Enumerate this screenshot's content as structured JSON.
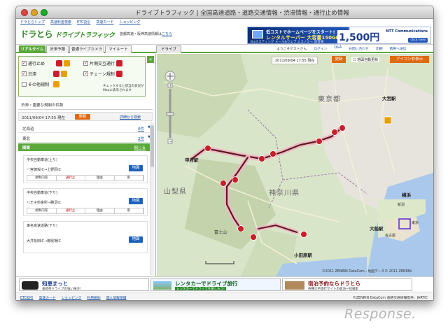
{
  "window": {
    "title": "ドライブトラフィック | 全国高速道路・道路交通情報・渋滞情報・通行止め情報"
  },
  "topnav": [
    "ドラとらトップ",
    "高速料金検索",
    "ETC割引",
    "高速カード",
    "ショッピング"
  ],
  "header": {
    "logo_main": "ドラとら",
    "logo_sub": "ドライブトラフィック",
    "area_note": "首都高速・阪神高速情報は",
    "area_link": "こちら"
  },
  "ad_top": {
    "line1": "低コストでホームページをスタート!",
    "line2": "レンタルサーバー 大容量150GB",
    "line3": "Bizホスティング メール&ウェブ エコノミー 新登場",
    "price": "1,500円",
    "brand": "NTT Communications",
    "click": "click here"
  },
  "tabs": [
    "リアルタイム",
    "渋滞予報",
    "普通ライブカメラ",
    "マイルート"
  ],
  "tab_drive": "ドライブ",
  "user_links": {
    "greeting": "ようこそゲストさん",
    "login": "ログイン",
    "qa": "Q&A",
    "contact": "お問い合わせ",
    "print": "印刷",
    "usage": "携帯へ送信"
  },
  "filters": {
    "items": [
      {
        "label": "通行止め",
        "checked": true
      },
      {
        "label": "片側交互通行",
        "checked": true
      },
      {
        "label": "渋滞",
        "checked": true
      },
      {
        "label": "チェーン規制",
        "checked": true
      },
      {
        "label": "その他規制",
        "checked": false
      }
    ],
    "note": "チェックすると該当の状況がMapに表示されます"
  },
  "section_title": "渋滞・重要な規制の件数",
  "timebar": {
    "time": "2011/09/04 17:55 現在",
    "update": "更新",
    "more": "詳細から検索"
  },
  "regions": [
    {
      "name": "北海道",
      "count": "0件"
    },
    {
      "name": "東北",
      "count": "2件"
    }
  ],
  "region_open": {
    "name": "関東",
    "close": "閉じる"
  },
  "roads": [
    {
      "name": "中央自動車道(上り)",
      "section": "一宮御坂IC→上野原IC",
      "map": "地図",
      "cols": [
        "規制内容",
        "通行止",
        "理由",
        "雨"
      ]
    },
    {
      "name": "中央自動車道(下り)",
      "section": "八王子料金所→勝沼IC",
      "map": "地図",
      "cols": [
        "規制内容",
        "通行止",
        "理由",
        "雨"
      ]
    },
    {
      "name": "東名高速道路(下り)",
      "section": "大井松田IC→御殿場IC",
      "map": "地図",
      "cols": []
    }
  ],
  "map": {
    "date": "2011/09/04 17:55 現在",
    "update": "更新",
    "check": "地図自動更新",
    "icon_btn": "アイコン非表示",
    "copyright": "©2011 ZENRIN DataCom・地図データ© 2011 ZENRIN",
    "labels": {
      "tokyo": "東京都",
      "yamanashi": "山梨県",
      "kanagawa": "神奈川県",
      "kofu": "甲府駅",
      "odawara": "小田原駅",
      "omiya": "大宮駅",
      "yokohama": "横浜",
      "ofuna": "大船駅",
      "fuji": "富士山",
      "mini_niigata": "新潟",
      "mini_tokyo": "東京",
      "mini_nagoya": "名古屋"
    },
    "colors": {
      "route": "#5a1a1a",
      "route_glow": "#f0b8c8",
      "icon_red": "#c8202a"
    }
  },
  "banners": [
    {
      "title": "知恵まっと",
      "sub": "長崎県ドライブの強い味方!"
    },
    {
      "title": "レンタカーでドライブ旅行",
      "sub": "レンタカーでドライブを楽しもう!"
    },
    {
      "title": "宿泊予約ならドラとら",
      "sub": "各種大手旅行サイトの宿泊一括検索"
    }
  ],
  "footer": {
    "links": [
      "ETC割引",
      "高速カード",
      "ショッピング",
      "利用規約",
      "個人情報保護"
    ],
    "copyright": "©ZENRIN DataCom 道路交通情報提供：JARTIC"
  },
  "watermark": "Response."
}
